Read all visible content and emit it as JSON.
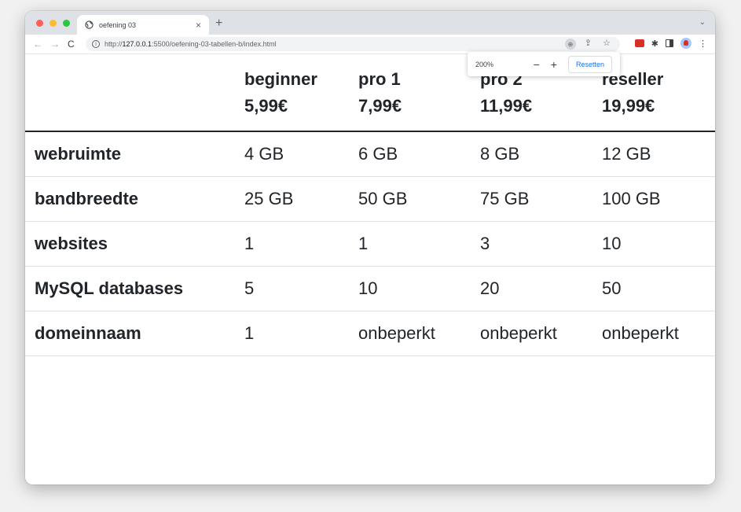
{
  "browser": {
    "tab_title": "oefening 03",
    "tab_close": "×",
    "new_tab": "+",
    "tab_menu": "⌄",
    "url_scheme": "http://",
    "url_host": "127.0.0.1",
    "url_rest": ":5500/oefening-03-tabellen-b/index.html"
  },
  "zoom_popup": {
    "level": "200%",
    "minus": "−",
    "plus": "+",
    "reset_label": "Resetten"
  },
  "table": {
    "headers": [
      {
        "name": "",
        "price": ""
      },
      {
        "name": "beginner",
        "price": "5,99€"
      },
      {
        "name": "pro 1",
        "price": "7,99€"
      },
      {
        "name": "pro 2",
        "price": "11,99€"
      },
      {
        "name": "reseller",
        "price": "19,99€"
      }
    ],
    "rows": [
      {
        "label": "webruimte",
        "values": [
          "4 GB",
          "6 GB",
          "8 GB",
          "12 GB"
        ]
      },
      {
        "label": "bandbreedte",
        "values": [
          "25 GB",
          "50 GB",
          "75 GB",
          "100 GB"
        ]
      },
      {
        "label": "websites",
        "values": [
          "1",
          "1",
          "3",
          "10"
        ]
      },
      {
        "label": "MySQL databases",
        "values": [
          "5",
          "10",
          "20",
          "50"
        ]
      },
      {
        "label": "domeinnaam",
        "values": [
          "1",
          "onbeperkt",
          "onbeperkt",
          "onbeperkt"
        ]
      }
    ]
  },
  "colors": {
    "text": "#212529",
    "accent": "#1a73e8"
  }
}
